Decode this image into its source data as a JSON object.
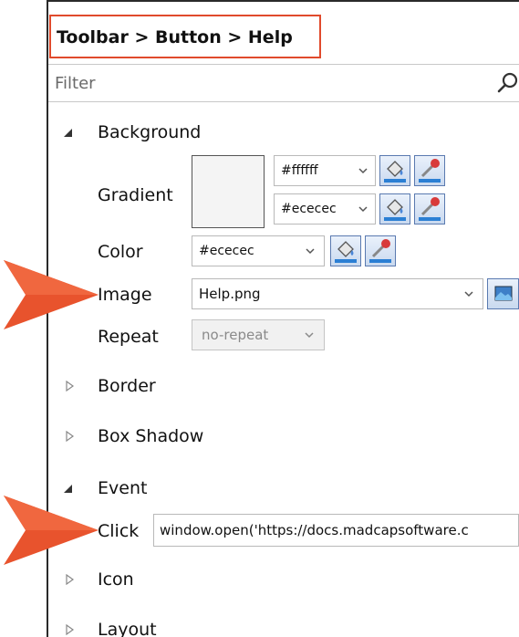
{
  "breadcrumb": "Toolbar > Button > Help",
  "filter": {
    "placeholder": "Filter"
  },
  "background": {
    "header": "Background",
    "gradient_label": "Gradient",
    "gradient_stop1": "#ffffff",
    "gradient_stop2": "#ececec",
    "color_label": "Color",
    "color_value": "#ececec",
    "image_label": "Image",
    "image_value": "Help.png",
    "repeat_label": "Repeat",
    "repeat_value": "no-repeat"
  },
  "sections": {
    "border": "Border",
    "box_shadow": "Box Shadow",
    "event": "Event",
    "icon": "Icon",
    "layout": "Layout"
  },
  "event": {
    "click_label": "Click",
    "click_value": "window.open('https://docs.madcapsoftware.c"
  },
  "colors": {
    "highlight_border": "#e04a2c",
    "callout_arrow": "#e8532d",
    "button_border": "#5a7ab0"
  },
  "icons": {
    "search": "magnifier",
    "fill": "paint-bucket",
    "picker": "eyedropper",
    "browse": "image-browse"
  }
}
